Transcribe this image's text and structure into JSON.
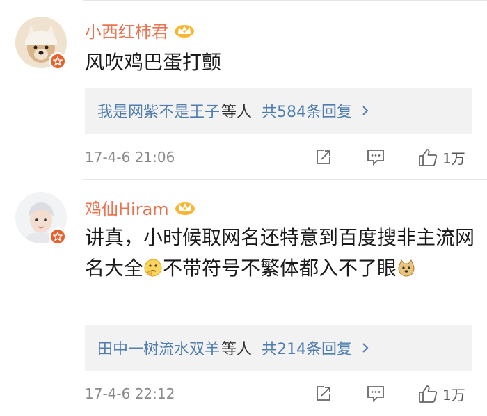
{
  "comments": [
    {
      "username": "小西红柿君",
      "text": "风吹鸡巴蛋打颤",
      "replies": {
        "names": "我是网紫不是王子",
        "suffix": "等人",
        "count": "共584条回复"
      },
      "time": "17-4-6 21:06",
      "likes": "1万"
    },
    {
      "username": "鸡仙Hiram",
      "text_part1": "讲真，小时候取网名还特意到百度搜非主流网名大全",
      "text_part2": "不带符号不繁体都入不了眼",
      "replies": {
        "names": "田中一树流水双羊",
        "suffix": "等人",
        "count": "共214条回复"
      },
      "time": "17-4-6 22:12",
      "likes": "1万"
    }
  ],
  "icons": {
    "vip": "crown-icon",
    "verified": "verified-badge-icon",
    "share": "share-icon",
    "comment": "comment-icon",
    "like": "thumb-up-icon",
    "emoji1": "thinking-emoji-icon",
    "emoji2": "doge-emoji-icon"
  },
  "colors": {
    "username": "#eb7350",
    "link": "#507daf",
    "badge": "#e8612c",
    "crown": "#f5a623"
  }
}
